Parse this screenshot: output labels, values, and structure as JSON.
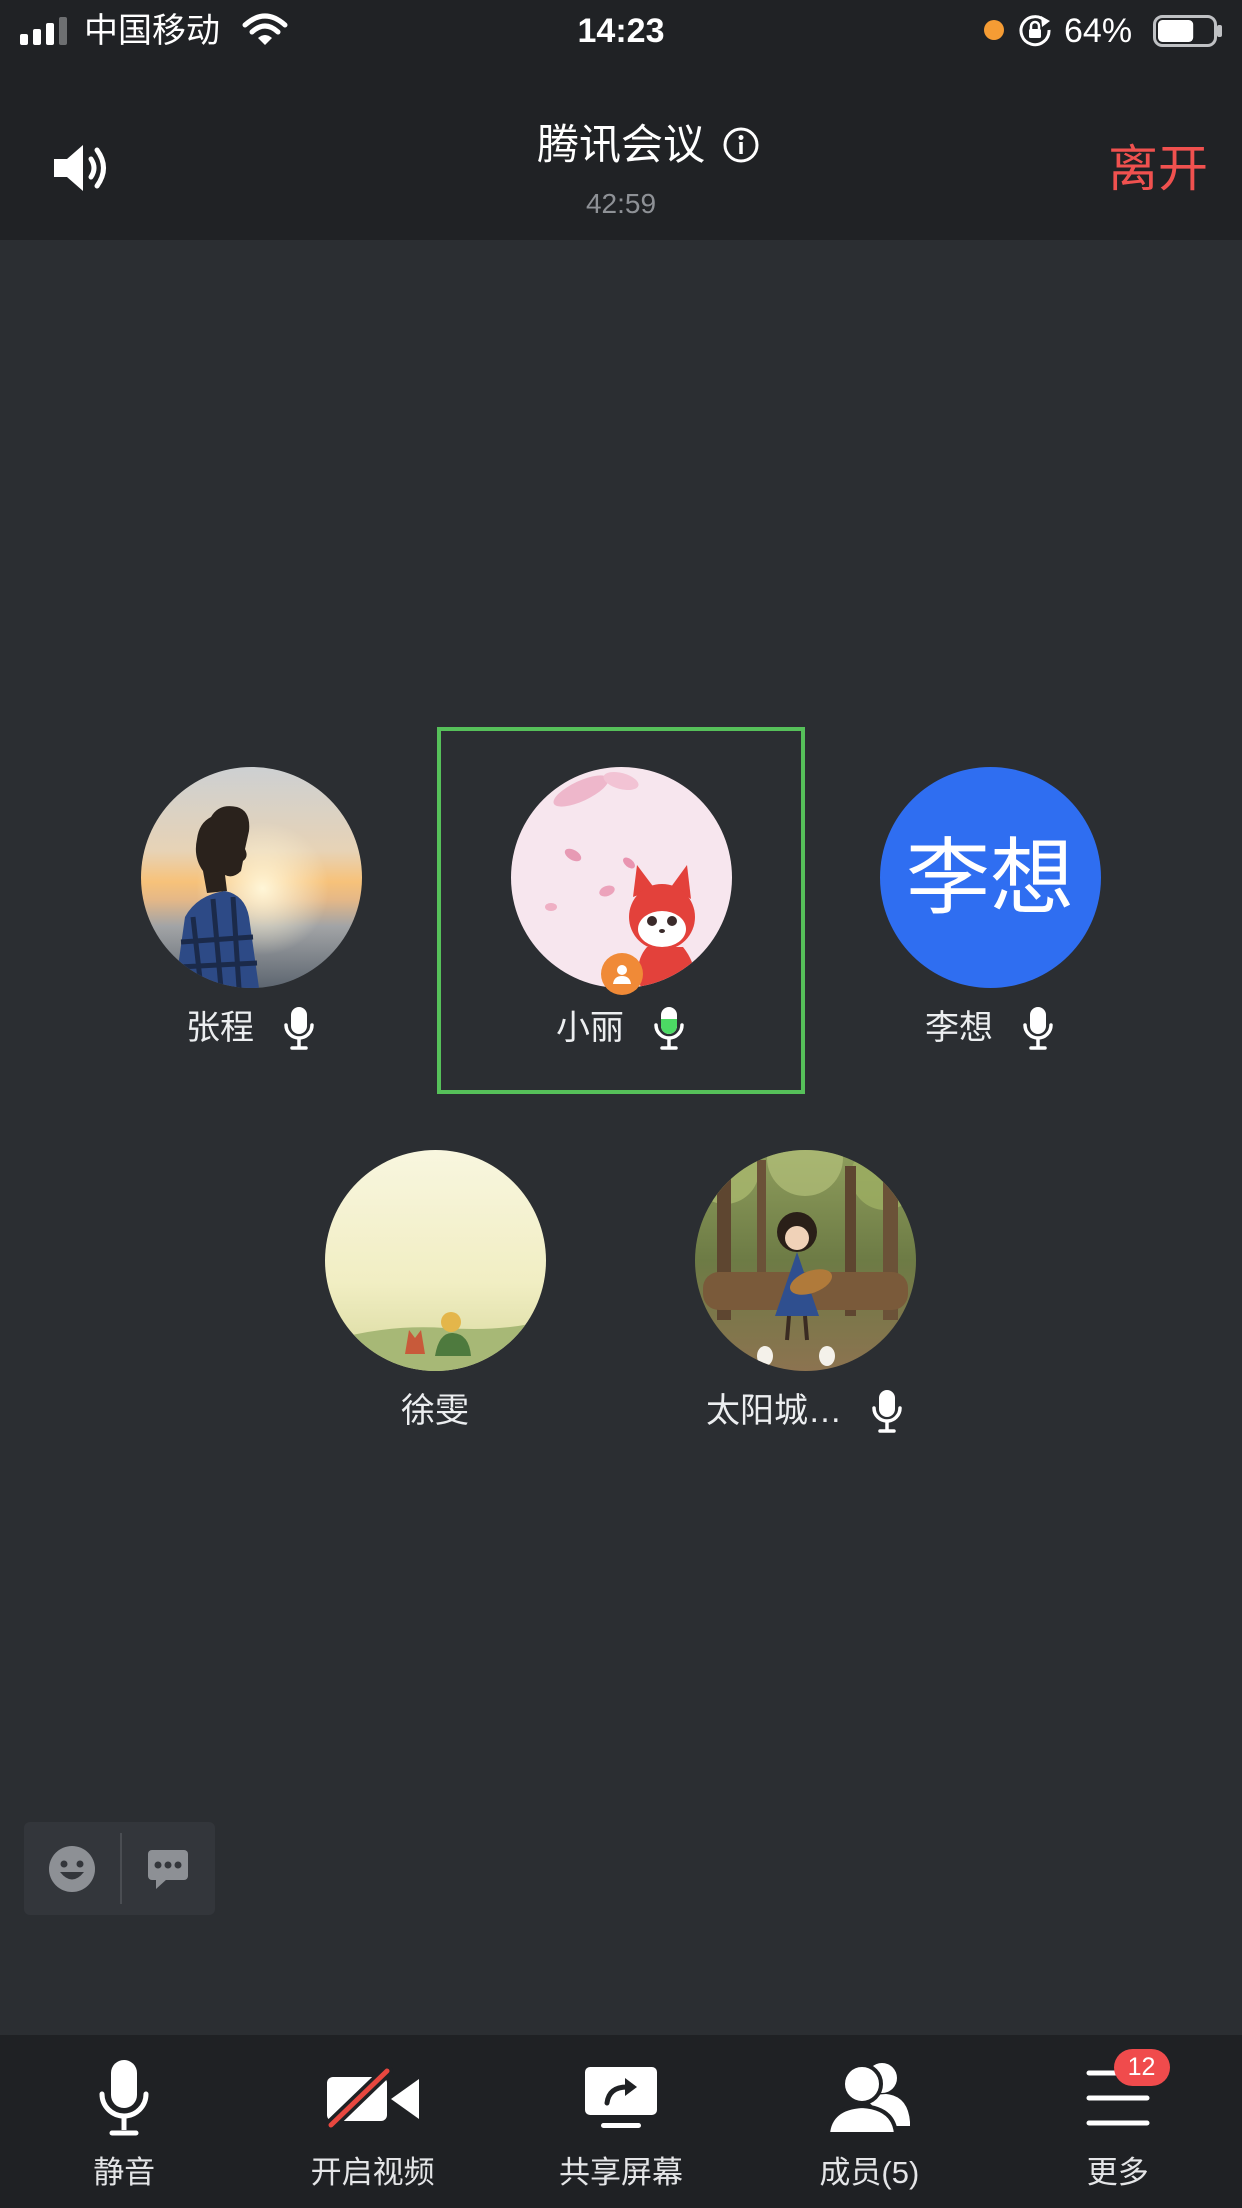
{
  "status_bar": {
    "carrier": "中国移动",
    "time": "14:23",
    "battery_text": "64%",
    "battery_level": 0.64,
    "signal_strength": 3,
    "signal_max": 4,
    "icons": [
      "signal-icon",
      "wifi-icon",
      "recording-dot",
      "rotation-lock-icon",
      "battery-icon"
    ]
  },
  "header": {
    "title": "腾讯会议",
    "duration": "42:59",
    "leave_label": "离开",
    "icons": [
      "speaker-icon",
      "info-icon"
    ]
  },
  "participants": [
    {
      "name": "张程",
      "mic_icon": "microphone-icon",
      "active": false,
      "host_icon": null
    },
    {
      "name": "小丽",
      "mic_icon": "microphone-active-icon",
      "active": true,
      "host_icon": "host-icon"
    },
    {
      "name": "李想",
      "mic_icon": "microphone-icon",
      "active": false,
      "host_icon": null,
      "avatar_text": "李想",
      "avatar_color": "#2f6ef1"
    },
    {
      "name": "徐雯",
      "mic_icon": null,
      "active": false,
      "host_icon": null
    },
    {
      "name": "太阳城…",
      "mic_icon": "microphone-icon",
      "active": false,
      "host_icon": null
    }
  ],
  "quick_actions": [
    {
      "icon": "emoji-icon"
    },
    {
      "icon": "chat-icon"
    }
  ],
  "toolbar": {
    "items": [
      {
        "label": "静音",
        "icon": "microphone-icon"
      },
      {
        "label": "开启视频",
        "icon": "video-off-icon"
      },
      {
        "label": "共享屏幕",
        "icon": "share-screen-icon"
      },
      {
        "label": "成员(5)",
        "icon": "members-icon"
      },
      {
        "label": "更多",
        "icon": "more-menu-icon",
        "badge": "12"
      }
    ]
  },
  "colors": {
    "background": "#2b2e32",
    "bar_background": "#202225",
    "toolbar_background": "#1f2124",
    "leave": "#f0514f",
    "active_speaker_border": "#56c05a",
    "speaking_mic": "#4cd964",
    "host_badge": "#f08a37",
    "notification_badge": "#f04b4c",
    "recording_dot": "#f59c34"
  }
}
